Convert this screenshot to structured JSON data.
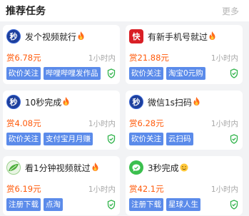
{
  "header": {
    "title": "推荐任务",
    "more": "更多"
  },
  "colors": {
    "reward": "#ff5a0a",
    "tag_bg": "#5b8bea",
    "shield": "#2fb34a"
  },
  "tasks": [
    {
      "icon": "seckill-badge-icon",
      "avatar_text": "秒",
      "title": "发个视频就行",
      "emoji": "fire-icon",
      "reward": "赏6.78元",
      "duration": "1小时内",
      "tags": [
        "砍价关注",
        "哔哩哔哩发作品"
      ]
    },
    {
      "icon": "kuaishou-app-icon",
      "avatar_text": "快",
      "title": "有新手机号就过",
      "emoji": "fire-icon",
      "reward": "赏21.88元",
      "duration": "1小时内",
      "tags": [
        "砍价关注",
        "淘宝0元购"
      ]
    },
    {
      "icon": "seckill-badge-icon",
      "avatar_text": "秒",
      "title": "10秒完成",
      "emoji": "fire-icon",
      "reward": "赏4.08元",
      "duration": "1小时内",
      "tags": [
        "砍价关注",
        "支付宝月月赚"
      ]
    },
    {
      "icon": "seckill-badge-icon",
      "avatar_text": "秒",
      "title": "微信1s扫码",
      "emoji": "fire-icon",
      "reward": "赏6.28元",
      "duration": "1小时内",
      "tags": [
        "砍价关注",
        "云扫码"
      ]
    },
    {
      "icon": "leaf-avatar-icon",
      "avatar_text": "",
      "title": "看1分钟视频就过",
      "emoji": "fire-icon",
      "reward": "赏6.19元",
      "duration": "1小时内",
      "tags": [
        "注册下载",
        "点淘"
      ]
    },
    {
      "icon": "green-chat-icon",
      "avatar_text": "",
      "title": "3秒完成",
      "emoji": "smile-emoji-icon",
      "reward": "赏42.1元",
      "duration": "1小时内",
      "tags": [
        "注册下载",
        "星球人生"
      ]
    }
  ]
}
